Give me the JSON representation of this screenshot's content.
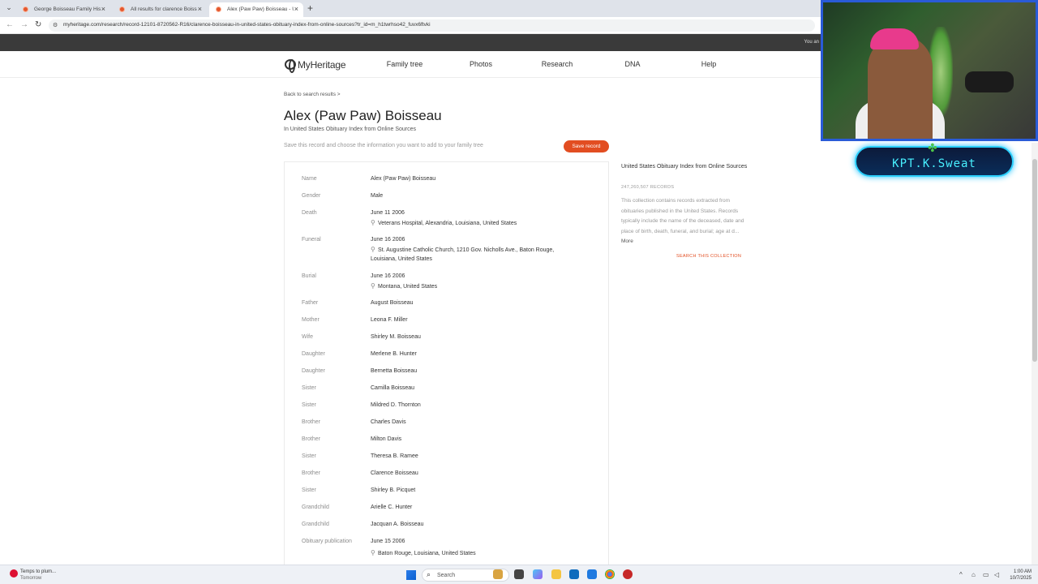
{
  "browser": {
    "tabs": [
      {
        "title": "George Boisseau Family Histor..."
      },
      {
        "title": "All results for clarence Boisseau"
      },
      {
        "title": "Alex (Paw Paw) Boisseau - Unit..."
      }
    ],
    "new_tab": "+",
    "url": "myheritage.com/research/record-12101-8720562-R16/clarence-boisseau-in-united-states-obituary-index-from-online-sources?tr_id=m_h1twrhso42_fuvx6ftvki",
    "top_strip_text": "You an"
  },
  "site": {
    "logo": "MyHeritage",
    "nav": [
      "Family tree",
      "Photos",
      "Research",
      "DNA",
      "Help"
    ]
  },
  "record": {
    "back_link": "Back to search results >",
    "title": "Alex (Paw Paw) Boisseau",
    "subtitle": "In United States Obituary Index from Online Sources",
    "save_info": "Save this record and choose the information you want to add to your family tree",
    "save_button": "Save record",
    "rows": [
      {
        "label": "Name",
        "value": "Alex (Paw Paw) Boisseau"
      },
      {
        "label": "Gender",
        "value": "Male"
      },
      {
        "label": "Death",
        "value": "June 11 2006",
        "place": "Veterans Hospital, Alexandria, Louisiana, United States"
      },
      {
        "label": "Funeral",
        "value": "June 16 2006",
        "place": "St. Augustine Catholic Church, 1210 Gov. Nicholls Ave., Baton Rouge,",
        "place2": "Louisiana, United States"
      },
      {
        "label": "Burial",
        "value": "June 16 2006",
        "place": "Montana, United States"
      },
      {
        "label": "Father",
        "value": "August Boisseau"
      },
      {
        "label": "Mother",
        "value": "Leona F. Miller"
      },
      {
        "label": "Wife",
        "value": "Shirley M. Boisseau"
      },
      {
        "label": "Daughter",
        "value": "Merlene B. Hunter"
      },
      {
        "label": "Daughter",
        "value": "Bernetta Boisseau"
      },
      {
        "label": "Sister",
        "value": "Camilla Boisseau"
      },
      {
        "label": "Sister",
        "value": "Mildred D. Thornton"
      },
      {
        "label": "Brother",
        "value": "Charles Davis"
      },
      {
        "label": "Brother",
        "value": "Milton Davis"
      },
      {
        "label": "Sister",
        "value": "Theresa B. Ramee"
      },
      {
        "label": "Brother",
        "value": "Clarence Boisseau"
      },
      {
        "label": "Sister",
        "value": "Shirley B. Picquet"
      },
      {
        "label": "Grandchild",
        "value": "Arielle C. Hunter"
      },
      {
        "label": "Grandchild",
        "value": "Jacquan A. Boisseau"
      },
      {
        "label": "Obituary publication",
        "value": "June 15 2006",
        "place": "Baton Rouge, Louisiana, United States"
      }
    ]
  },
  "collection": {
    "title": "United States Obituary Index from Online Sources",
    "count": "247,260,507 RECORDS",
    "description": "This collection contains records extracted from obituaries published in the United States. Records typically include the name of the deceased, date and place of birth, death, funeral, and burial; age at d...",
    "more": "More",
    "search_link": "SEARCH THIS COLLECTION"
  },
  "overlay": {
    "badge_text": "KPT.K.Sweat"
  },
  "taskbar": {
    "weather_line1": "Temps to plum...",
    "weather_line2": "Tomorrow",
    "search_placeholder": "Search",
    "time": "1:00 AM",
    "date": "10/7/2025"
  },
  "colors": {
    "accent": "#e24d21",
    "webcam_border": "#2a5bd7",
    "badge_glow": "#2ad0ff"
  }
}
